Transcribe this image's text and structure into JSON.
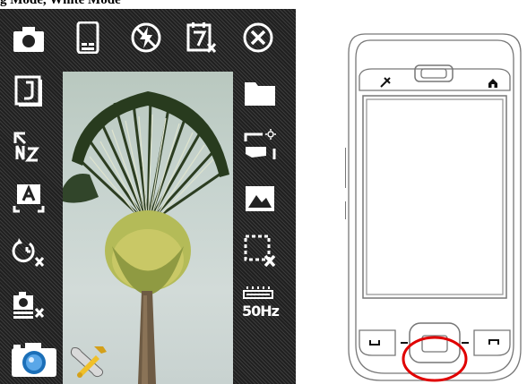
{
  "caption": "g Mode, White Mode",
  "camera": {
    "top_icons": [
      "camera-mode-icon",
      "storage-device-icon",
      "flash-off-icon",
      "timestamp-off-icon",
      "close-icon"
    ],
    "left_icons": [
      "image-size-icon",
      "quality-icon",
      "auto-mode-icon",
      "self-timer-off-icon",
      "burst-off-icon"
    ],
    "right_icons": [
      "folder-icon",
      "brightness-icon",
      "scene-icon",
      "frame-off-icon",
      "flicker-icon"
    ],
    "bottom_icons": [
      "capture-icon",
      "settings-icon"
    ],
    "flicker_label": "50Hz",
    "quality_label": "J",
    "mode_label": "A"
  },
  "device": {
    "illustration": "pda-phone-outline",
    "highlight_color": "#e00000"
  }
}
